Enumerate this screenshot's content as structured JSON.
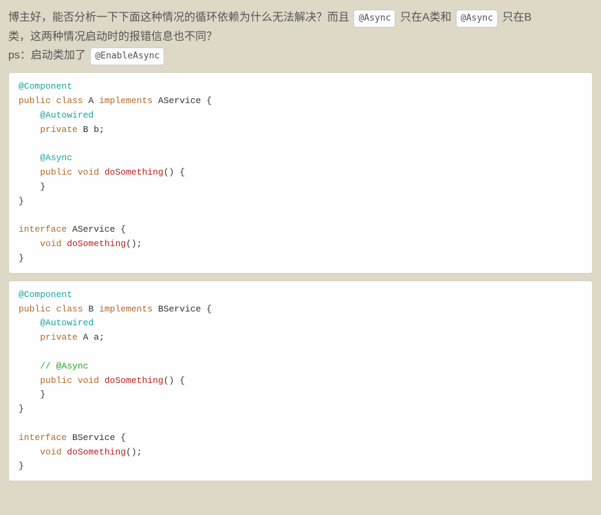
{
  "question": {
    "line1_part1": "博主好，能否分析一下下面这种情况的循环依赖为什么无法解决？而且 ",
    "inline_async1": "@Async",
    "line1_part2": " 只在A类和 ",
    "inline_async2": "@Async",
    "line1_part3": " 只在B",
    "line2": "类，这两种情况启动时的报错信息也不同？",
    "line3_prefix": "ps：启动类加了 ",
    "inline_enable": "@EnableAsync"
  },
  "code_a": {
    "annot_component": "@Component",
    "kw_public": "public",
    "kw_class": "class",
    "name_class": "A",
    "kw_implements": "implements",
    "name_iface": "AService",
    "annot_autowired": "@Autowired",
    "kw_private": "private",
    "field_type": "B",
    "field_name": "b",
    "annot_async": "@Async",
    "kw_void": "void",
    "method": "doSomething",
    "iface_kw": "interface",
    "iface_name": "AService",
    "iface_method": "doSomething"
  },
  "code_b": {
    "annot_component": "@Component",
    "kw_public": "public",
    "kw_class": "class",
    "name_class": "B",
    "kw_implements": "implements",
    "name_iface": "BService",
    "annot_autowired": "@Autowired",
    "kw_private": "private",
    "field_type": "A",
    "field_name": "a",
    "comment_async": "// @Async",
    "kw_void": "void",
    "method": "doSomething",
    "iface_kw": "interface",
    "iface_name": "BService",
    "iface_method": "doSomething"
  }
}
